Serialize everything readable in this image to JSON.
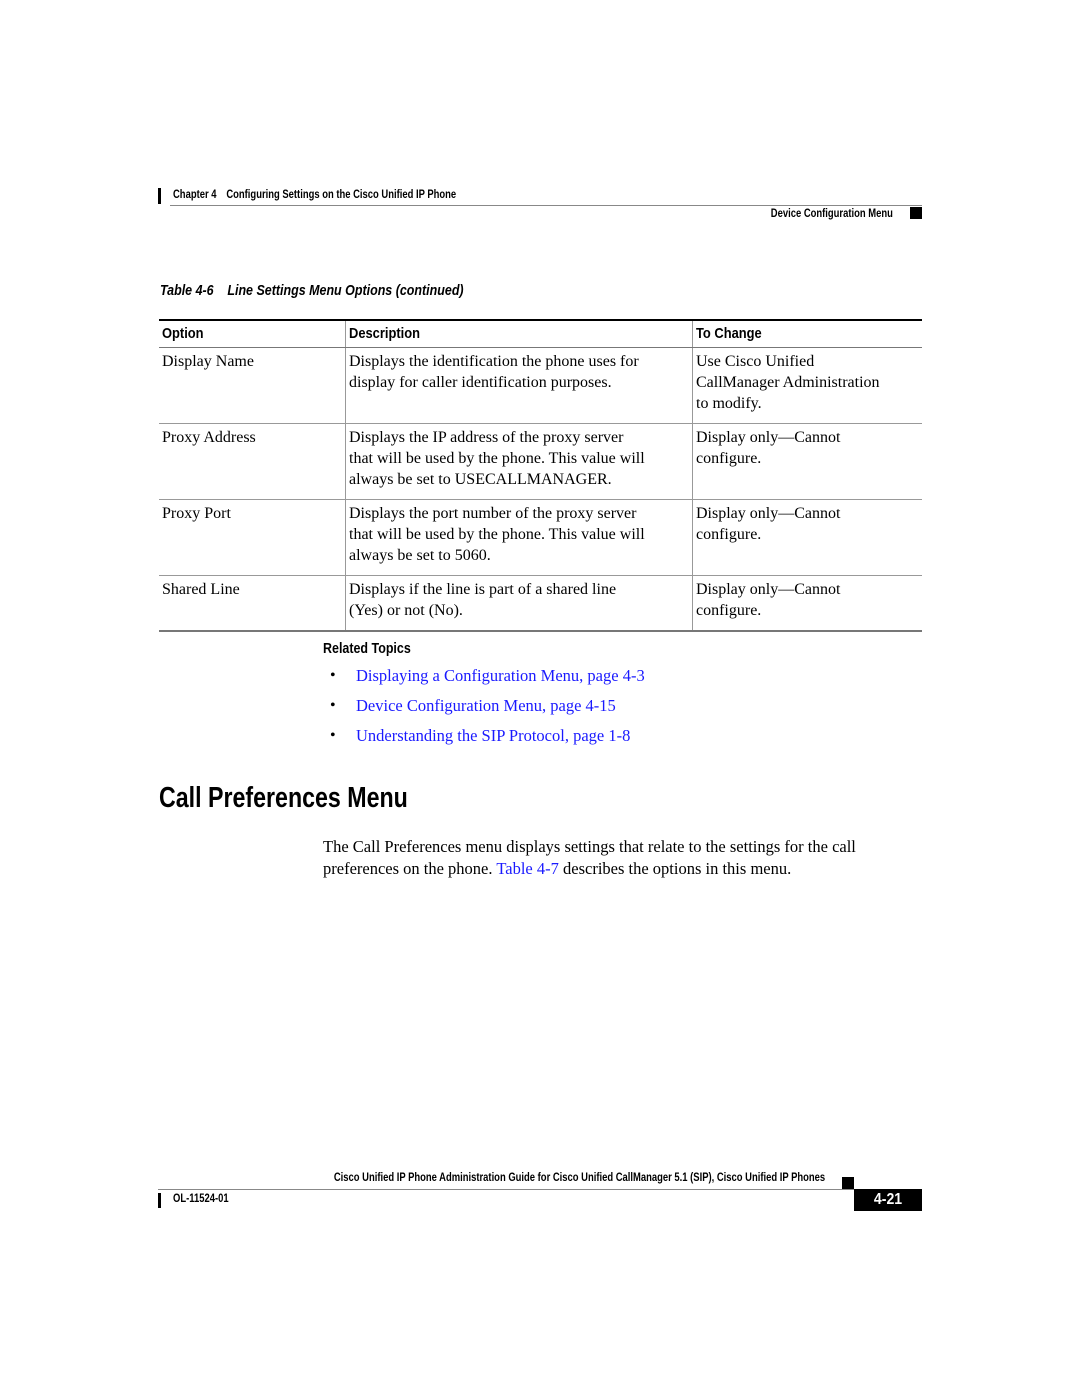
{
  "header": {
    "chapter_label": "Chapter 4",
    "chapter_title": "Configuring Settings on the Cisco Unified IP Phone",
    "section_title": "Device Configuration Menu"
  },
  "table": {
    "caption_number": "Table 4-6",
    "caption_title": "Line Settings Menu Options (continued)",
    "columns": [
      "Option",
      "Description",
      "To Change"
    ],
    "rows": [
      {
        "option": [
          "Display Name"
        ],
        "description": [
          "Displays the identification the phone uses for",
          "display for caller identification purposes."
        ],
        "to_change": [
          "Use Cisco Unified",
          "CallManager Administration",
          "to modify."
        ]
      },
      {
        "option": [
          "Proxy Address"
        ],
        "description": [
          "Displays the IP address of the proxy server",
          "that will be used by the phone. This value will",
          "always be set to USECALLMANAGER."
        ],
        "to_change": [
          "Display only—Cannot",
          "configure."
        ]
      },
      {
        "option": [
          "Proxy Port"
        ],
        "description": [
          "Displays the port number of the proxy server",
          "that will be used by the phone. This value will",
          "always be set to 5060."
        ],
        "to_change": [
          "Display only—Cannot",
          "configure."
        ]
      },
      {
        "option": [
          "Shared Line"
        ],
        "description": [
          "Displays if the line is part of a shared line",
          "(Yes) or not (No)."
        ],
        "to_change": [
          "Display only—Cannot",
          "configure."
        ]
      }
    ]
  },
  "related_topics": {
    "title": "Related Topics",
    "bullet": "•",
    "links": [
      "Displaying a Configuration Menu, page 4-3",
      "Device Configuration Menu, page 4-15",
      "Understanding the SIP Protocol, page 1-8"
    ]
  },
  "section": {
    "heading": "Call Preferences Menu",
    "paragraph": {
      "line1": "The Call Preferences menu displays settings that relate to the settings for the call",
      "line2_before": "preferences on the phone. ",
      "line2_link": "Table 4-7",
      "line2_after": " describes the options in this menu."
    }
  },
  "footer": {
    "guide_title": "Cisco Unified IP Phone Administration Guide for Cisco Unified CallManager 5.1 (SIP), Cisco Unified IP Phones",
    "doc_number": "OL-11524-01",
    "page_number": "4-21"
  },
  "colors": {
    "link": "#1a1aff",
    "text": "#000000",
    "rule": "#888888"
  }
}
